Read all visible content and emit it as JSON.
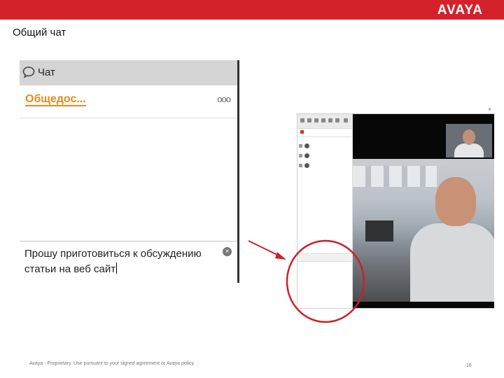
{
  "brand": {
    "logo_text": "AVAYA",
    "accent_color": "#d3222a"
  },
  "slide": {
    "title": "Общий чат",
    "page_number": "16"
  },
  "footer": {
    "text": "Avaya - Proprietary. Use pursuant to your signed agreement or Avaya policy."
  },
  "chat": {
    "header_label": "Чат",
    "header_icon": "chat-bubble-icon",
    "conversation_name": "Общедос...",
    "more_label": "ooo",
    "message_input_value": "Прошу приготовиться к обсуждению статьи на веб сайт",
    "clear_label": "×",
    "accent_color": "#e38a1d"
  },
  "mini_app": {
    "close_label": "✕"
  }
}
